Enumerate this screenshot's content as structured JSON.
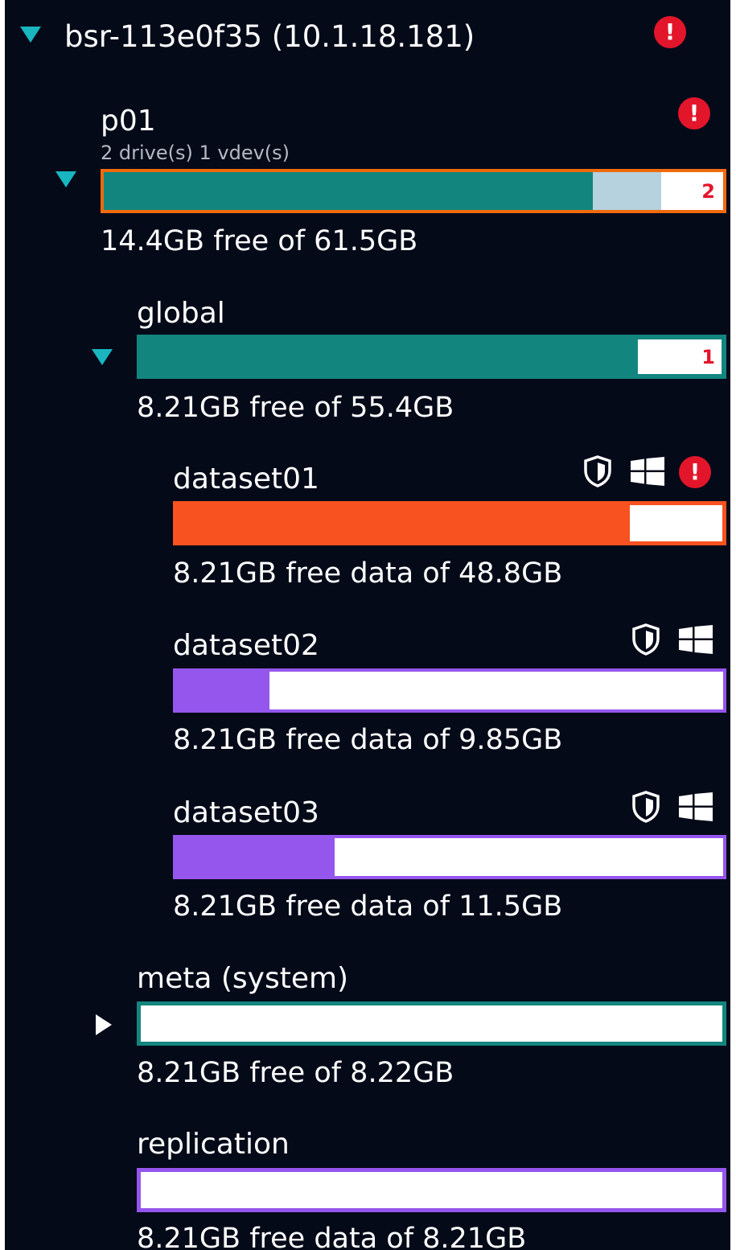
{
  "server": {
    "label": "bsr-113e0f35 (10.1.18.181)"
  },
  "pool": {
    "name": "p01",
    "sub": "2 drive(s) 1 vdev(s)",
    "count": "2",
    "used_fraction": 0.79,
    "pending_fraction": 0.11,
    "free_text": "14.4GB free of 61.5GB"
  },
  "global": {
    "name": "global",
    "count": "1",
    "used_fraction": 0.85,
    "free_text": "8.21GB free of 55.4GB"
  },
  "datasets": [
    {
      "name": "dataset01",
      "used_fraction": 0.83,
      "free_text": "8.21GB free data of 48.8GB"
    },
    {
      "name": "dataset02",
      "used_fraction": 0.17,
      "free_text": "8.21GB free data of 9.85GB"
    },
    {
      "name": "dataset03",
      "used_fraction": 0.29,
      "free_text": "8.21GB free data of 11.5GB"
    }
  ],
  "meta": {
    "name": "meta (system)",
    "used_fraction": 0.0,
    "free_text": "8.21GB free of 8.22GB"
  },
  "replication": {
    "name": "replication",
    "used_fraction": 0.0,
    "free_text": "8.21GB free data of 8.21GB"
  },
  "icons": {
    "expanded": "caret-down-icon",
    "collapsed": "caret-right-icon",
    "alert": "alert-icon",
    "shield": "shield-icon",
    "windows": "windows-icon"
  },
  "colors": {
    "background": "#050a19",
    "teal": "#12867e",
    "pending": "#b5d2de",
    "orange_border": "#f06a0e",
    "orange_fill": "#f75220",
    "purple": "#9556ee",
    "alert_red": "#e3152b",
    "expander": "#19b6c0"
  },
  "alert_glyph": "!"
}
